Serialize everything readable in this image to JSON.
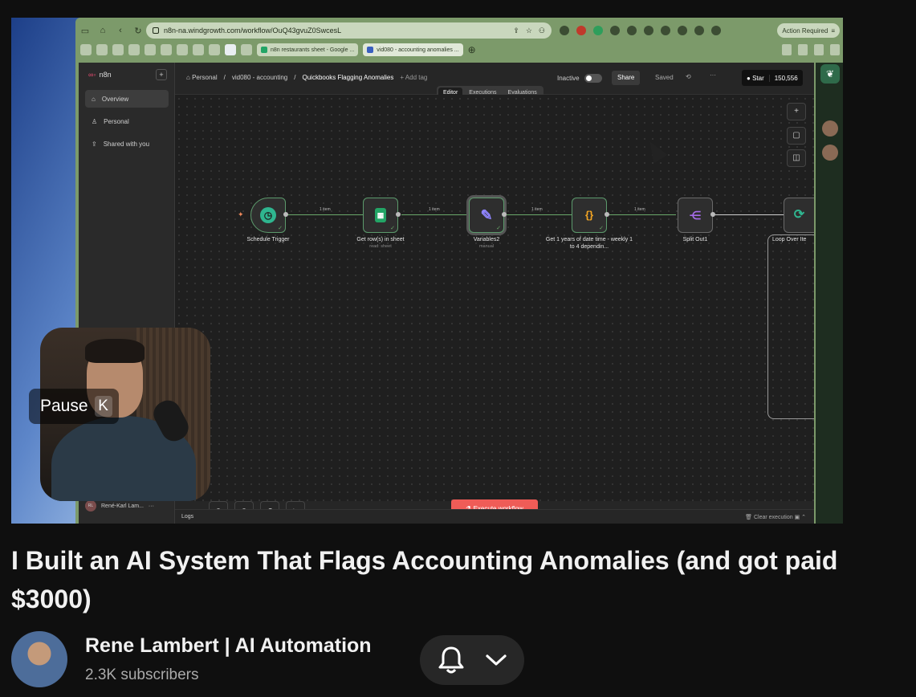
{
  "browser": {
    "url": "n8n-na.windgrowth.com/workflow/OuQ43gvuZ0SwcesL",
    "action_required": "Action Required",
    "tabs": [
      "n8n restaurants sheet - Google ...",
      "vid080 - accounting anomalies ..."
    ]
  },
  "sidebar": {
    "logo": "n8n",
    "items": [
      {
        "label": "Overview",
        "icon": "home-icon"
      },
      {
        "label": "Personal",
        "icon": "user-icon"
      },
      {
        "label": "Shared with you",
        "icon": "share-icon"
      }
    ],
    "user": {
      "initials": "RL",
      "name": "René-Karl Lam..."
    }
  },
  "topbar": {
    "breadcrumb_personal": "Personal",
    "breadcrumb_project": "vid080 - accounting",
    "workflow_name": "Quickbooks Flagging Anomalies",
    "add_tag": "+ Add tag",
    "inactive_label": "Inactive",
    "share_label": "Share",
    "saved_label": "Saved",
    "more_label": "···",
    "star_label": "Star",
    "star_count": "150,556",
    "tabs": [
      "Editor",
      "Executions",
      "Evaluations"
    ]
  },
  "workflow": {
    "nodes": [
      {
        "name": "Schedule Trigger",
        "sub": "",
        "icon": "clock-icon",
        "color": "#2fb58f"
      },
      {
        "name": "Get row(s) in sheet",
        "sub": "read: sheet",
        "icon": "sheets-icon",
        "color": "#23a566"
      },
      {
        "name": "Variables2",
        "sub": "manual",
        "icon": "pencil-icon",
        "color": "#7b6cf6"
      },
      {
        "name": "Get 1 years of date time - weekly 1 to 4 dependin...",
        "sub": "",
        "icon": "braces-icon",
        "color": "#f5a623"
      },
      {
        "name": "Split Out1",
        "sub": "",
        "icon": "split-icon",
        "color": "#a66be8"
      },
      {
        "name": "Loop Over Ite",
        "sub": "",
        "icon": "loop-icon",
        "color": "#2fb58f"
      }
    ],
    "edge_labels": [
      "1 item",
      "1 item",
      "1 item",
      "1 item"
    ]
  },
  "bottom": {
    "execute_label": "Execute workflow",
    "logs_label": "Logs",
    "clear_label": "Clear execution"
  },
  "overlay": {
    "pause_label": "Pause",
    "pause_key": "K"
  },
  "video": {
    "title": "I Built an AI System That Flags Accounting Anomalies (and got paid $3000)",
    "channel": "Rene Lambert | AI Automation",
    "subscribers": "2.3K subscribers"
  },
  "colors": {
    "accent": "#ef5c57",
    "edge_active": "#6aa86a",
    "background": "#0f0f0f"
  }
}
